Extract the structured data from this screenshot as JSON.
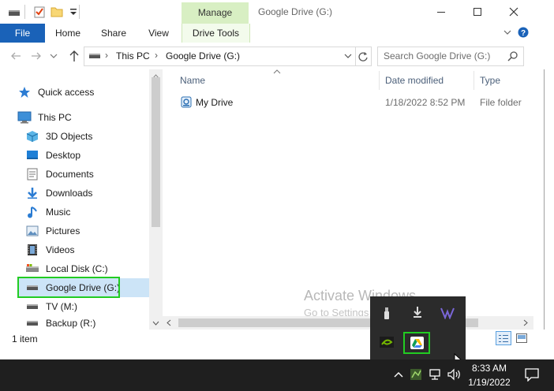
{
  "titlebar": {
    "manage_label": "Manage",
    "window_title": "Google Drive (G:)",
    "minimize_icon": "minimize-icon",
    "maximize_icon": "maximize-icon",
    "close_icon": "close-icon"
  },
  "ribbon": {
    "tabs": [
      {
        "label": "File"
      },
      {
        "label": "Home"
      },
      {
        "label": "Share"
      },
      {
        "label": "View"
      },
      {
        "label": "Drive Tools"
      }
    ]
  },
  "address": {
    "crumbs": [
      "This PC",
      "Google Drive (G:)"
    ],
    "search_placeholder": "Search Google Drive (G:)"
  },
  "nav": {
    "items": [
      {
        "label": "Quick access",
        "icon": "star-icon"
      },
      {
        "label": "This PC",
        "icon": "computer-icon"
      },
      {
        "label": "3D Objects",
        "icon": "cube-icon"
      },
      {
        "label": "Desktop",
        "icon": "desktop-icon"
      },
      {
        "label": "Documents",
        "icon": "document-icon"
      },
      {
        "label": "Downloads",
        "icon": "download-icon"
      },
      {
        "label": "Music",
        "icon": "music-icon"
      },
      {
        "label": "Pictures",
        "icon": "picture-icon"
      },
      {
        "label": "Videos",
        "icon": "video-icon"
      },
      {
        "label": "Local Disk (C:)",
        "icon": "disk-icon"
      },
      {
        "label": "Google Drive (G:)",
        "icon": "drive-icon"
      },
      {
        "label": "TV (M:)",
        "icon": "drive-icon"
      },
      {
        "label": "Backup (R:)",
        "icon": "drive-icon"
      }
    ]
  },
  "columns": {
    "name": "Name",
    "date": "Date modified",
    "type": "Type"
  },
  "files": [
    {
      "name": "My Drive",
      "date": "1/18/2022 8:52 PM",
      "type": "File folder"
    }
  ],
  "status": {
    "count": "1 item"
  },
  "watermark": {
    "line1": "Activate Windows",
    "line2": "Go to Settings to activate Windows."
  },
  "taskbar": {
    "time": "8:33 AM",
    "date": "1/19/2022"
  },
  "colors": {
    "accent": "#1a62b8",
    "manage_tab": "#d8efc3",
    "highlight_box": "#22cc22",
    "taskbar": "#1f1f1f"
  }
}
